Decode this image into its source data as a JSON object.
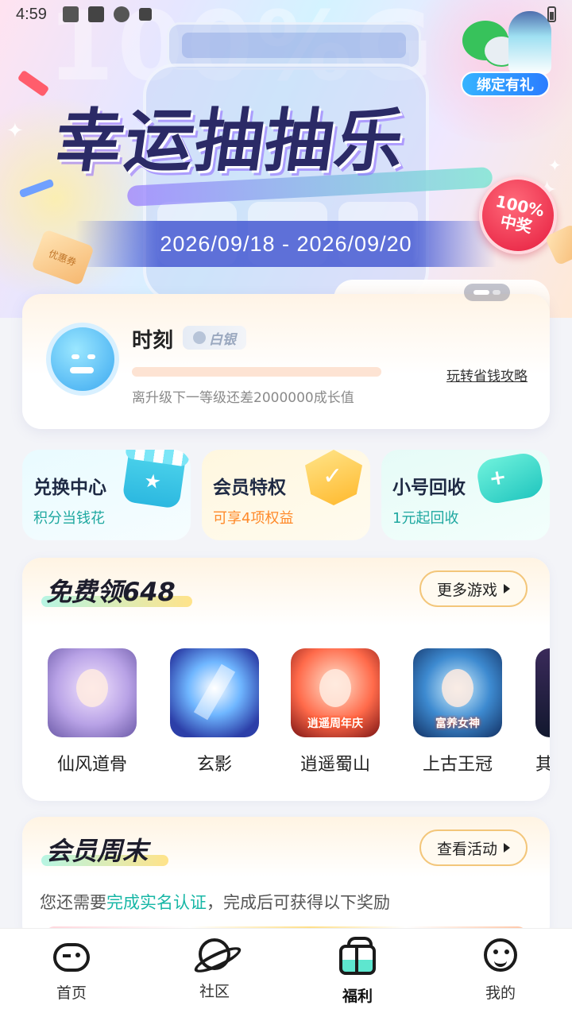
{
  "status_bar": {
    "time": "4:59",
    "icons": [
      "image-icon",
      "square-icon",
      "aperture-icon",
      "a-icon",
      "battery-icon"
    ]
  },
  "banner": {
    "watermark": "100%G",
    "title": "幸运抽抽乐",
    "date_range": "2026/09/18  -  2026/09/20",
    "badge_line1": "100%",
    "badge_line2": "中奖",
    "coupon_text": "优惠券",
    "bind_label": "绑定有礼",
    "pager_count": 2,
    "pager_active": 0
  },
  "profile": {
    "name": "时刻",
    "level": "白银",
    "progress_percent": 0,
    "progress_text": "离升级下一等级还差2000000成长值",
    "guide_link": "玩转省钱攻略"
  },
  "quick_cards": [
    {
      "title": "兑换中心",
      "subtitle": "积分当钱花",
      "icon": "shop-icon"
    },
    {
      "title": "会员特权",
      "subtitle": "可享4项权益",
      "icon": "vip-shield-icon"
    },
    {
      "title": "小号回收",
      "subtitle": "1元起回收",
      "icon": "gamepad-icon"
    }
  ],
  "free648": {
    "title": "免费领648",
    "more_label": "更多游戏",
    "games": [
      {
        "name": "仙风道骨",
        "caption": ""
      },
      {
        "name": "玄影",
        "caption": ""
      },
      {
        "name": "逍遥蜀山",
        "caption": "逍遥周年庆"
      },
      {
        "name": "上古王冠",
        "caption": "富养女神"
      },
      {
        "name": "其",
        "caption": ""
      }
    ]
  },
  "member_weekend": {
    "title": "会员周末",
    "button_label": "查看活动",
    "notice_prefix": "您还需要",
    "notice_highlight": "完成实名认证",
    "notice_suffix": "，完成后可获得以下奖励"
  },
  "tabbar": {
    "active": 2,
    "tabs": [
      {
        "label": "首页",
        "icon": "gamepad-home-icon"
      },
      {
        "label": "社区",
        "icon": "planet-icon"
      },
      {
        "label": "福利",
        "icon": "gift-icon"
      },
      {
        "label": "我的",
        "icon": "smile-face-icon"
      }
    ]
  }
}
